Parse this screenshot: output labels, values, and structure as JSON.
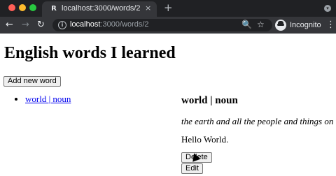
{
  "browser": {
    "tab": {
      "favicon": "R",
      "title": "localhost:3000/words/2",
      "close": "×"
    },
    "new_tab": "+",
    "nav": {
      "back": "←",
      "forward": "→",
      "reload": "↻"
    },
    "address": {
      "host": "localhost",
      "path": ":3000/words/2"
    },
    "icons": {
      "zoom": "🔍",
      "star": "☆",
      "info": "i",
      "tab_menu": "▾",
      "kebab": "⋮"
    },
    "profile": {
      "label": "Incognito"
    }
  },
  "page": {
    "title": "English words I learned",
    "add_button": "Add new word",
    "words": [
      {
        "label": "world | noun"
      }
    ],
    "detail": {
      "title": "world | noun",
      "definition": "the earth and all the people and things on it",
      "example": "Hello World.",
      "delete_button": "Delete",
      "edit_button": "Edit"
    }
  }
}
